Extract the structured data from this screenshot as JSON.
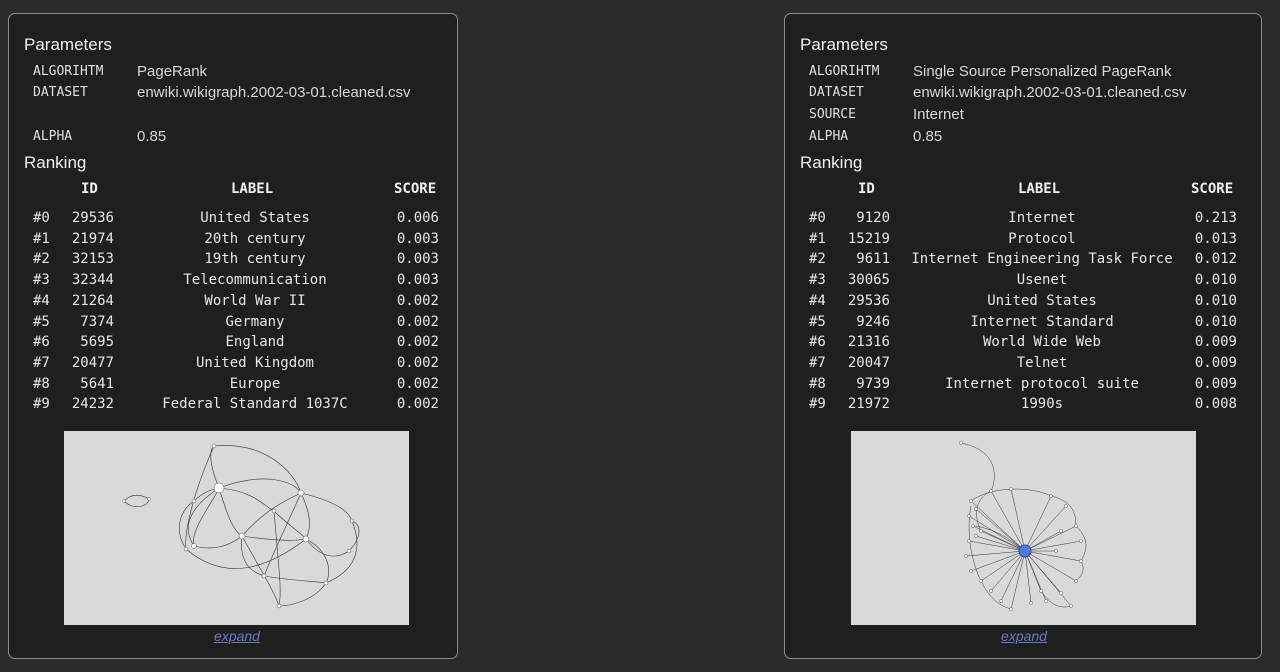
{
  "left": {
    "params_title": "Parameters",
    "params": [
      {
        "key": "ALGORIHTM",
        "value": "PageRank"
      },
      {
        "key": "DATASET",
        "value": "enwiki.wikigraph.2002-03-01.cleaned.csv"
      },
      {
        "key": "ALPHA",
        "value": "0.85"
      }
    ],
    "ranking_title": "Ranking",
    "headers": {
      "id": "ID",
      "label": "LABEL",
      "score": "SCORE"
    },
    "rows": [
      {
        "rank": "#0",
        "id": "29536",
        "label": "United States",
        "score": "0.006"
      },
      {
        "rank": "#1",
        "id": "21974",
        "label": "20th century",
        "score": "0.003"
      },
      {
        "rank": "#2",
        "id": "32153",
        "label": "19th century",
        "score": "0.003"
      },
      {
        "rank": "#3",
        "id": "32344",
        "label": "Telecommunication",
        "score": "0.003"
      },
      {
        "rank": "#4",
        "id": "21264",
        "label": "World War II",
        "score": "0.002"
      },
      {
        "rank": "#5",
        "id": "7374",
        "label": "Germany",
        "score": "0.002"
      },
      {
        "rank": "#6",
        "id": "5695",
        "label": "England",
        "score": "0.002"
      },
      {
        "rank": "#7",
        "id": "20477",
        "label": "United Kingdom",
        "score": "0.002"
      },
      {
        "rank": "#8",
        "id": "5641",
        "label": "Europe",
        "score": "0.002"
      },
      {
        "rank": "#9",
        "id": "24232",
        "label": "Federal Standard 1037C",
        "score": "0.002"
      }
    ],
    "expand_label": "expand"
  },
  "right": {
    "params_title": "Parameters",
    "params": [
      {
        "key": "ALGORIHTM",
        "value": "Single Source Personalized PageRank"
      },
      {
        "key": "DATASET",
        "value": "enwiki.wikigraph.2002-03-01.cleaned.csv"
      },
      {
        "key": "SOURCE",
        "value": "Internet"
      },
      {
        "key": "ALPHA",
        "value": "0.85"
      }
    ],
    "ranking_title": "Ranking",
    "headers": {
      "id": "ID",
      "label": "LABEL",
      "score": "SCORE"
    },
    "rows": [
      {
        "rank": "#0",
        "id": "9120",
        "label": "Internet",
        "score": "0.213"
      },
      {
        "rank": "#1",
        "id": "15219",
        "label": "Protocol",
        "score": "0.013"
      },
      {
        "rank": "#2",
        "id": "9611",
        "label": "Internet Engineering Task Force",
        "score": "0.012"
      },
      {
        "rank": "#3",
        "id": "30065",
        "label": "Usenet",
        "score": "0.010"
      },
      {
        "rank": "#4",
        "id": "29536",
        "label": "United States",
        "score": "0.010"
      },
      {
        "rank": "#5",
        "id": "9246",
        "label": "Internet Standard",
        "score": "0.010"
      },
      {
        "rank": "#6",
        "id": "21316",
        "label": "World Wide Web",
        "score": "0.009"
      },
      {
        "rank": "#7",
        "id": "20047",
        "label": "Telnet",
        "score": "0.009"
      },
      {
        "rank": "#8",
        "id": "9739",
        "label": "Internet protocol suite",
        "score": "0.009"
      },
      {
        "rank": "#9",
        "id": "21972",
        "label": "1990s",
        "score": "0.008"
      }
    ],
    "expand_label": "expand"
  },
  "colors": {
    "source_node": "#4f7bd8",
    "link": "#6d79c6"
  }
}
